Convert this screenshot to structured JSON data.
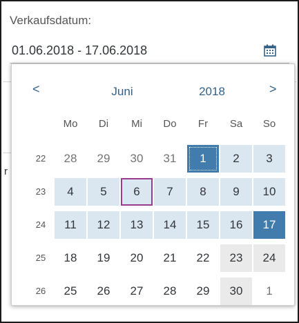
{
  "field": {
    "label": "Verkaufsdatum:",
    "value": "01.06.2018 - 17.06.2018",
    "icon": "calendar-icon"
  },
  "background": {
    "fragment": "r"
  },
  "calendar": {
    "prev": "<",
    "next": ">",
    "month": "Juni",
    "year": "2018",
    "weekdays": [
      "Mo",
      "Di",
      "Mi",
      "Do",
      "Fr",
      "Sa",
      "So"
    ],
    "colors": {
      "accent": "#346187",
      "range": "#dae6f0",
      "endpoint": "#427cac",
      "weekend": "#eaeaea",
      "today_border": "#9b3b8f"
    },
    "weeks": [
      {
        "week": "22",
        "days": [
          {
            "d": "28",
            "type": "other"
          },
          {
            "d": "29",
            "type": "other"
          },
          {
            "d": "30",
            "type": "other"
          },
          {
            "d": "31",
            "type": "other"
          },
          {
            "d": "1",
            "type": "start"
          },
          {
            "d": "2",
            "type": "range"
          },
          {
            "d": "3",
            "type": "range"
          }
        ]
      },
      {
        "week": "23",
        "days": [
          {
            "d": "4",
            "type": "range"
          },
          {
            "d": "5",
            "type": "range"
          },
          {
            "d": "6",
            "type": "today"
          },
          {
            "d": "7",
            "type": "range"
          },
          {
            "d": "8",
            "type": "range"
          },
          {
            "d": "9",
            "type": "range"
          },
          {
            "d": "10",
            "type": "range"
          }
        ]
      },
      {
        "week": "24",
        "days": [
          {
            "d": "11",
            "type": "range"
          },
          {
            "d": "12",
            "type": "range"
          },
          {
            "d": "13",
            "type": "range"
          },
          {
            "d": "14",
            "type": "range"
          },
          {
            "d": "15",
            "type": "range"
          },
          {
            "d": "16",
            "type": "range"
          },
          {
            "d": "17",
            "type": "end"
          }
        ]
      },
      {
        "week": "25",
        "days": [
          {
            "d": "18",
            "type": "normal"
          },
          {
            "d": "19",
            "type": "normal"
          },
          {
            "d": "20",
            "type": "normal"
          },
          {
            "d": "21",
            "type": "normal"
          },
          {
            "d": "22",
            "type": "normal"
          },
          {
            "d": "23",
            "type": "weekend"
          },
          {
            "d": "24",
            "type": "weekend"
          }
        ]
      },
      {
        "week": "26",
        "days": [
          {
            "d": "25",
            "type": "normal"
          },
          {
            "d": "26",
            "type": "normal"
          },
          {
            "d": "27",
            "type": "normal"
          },
          {
            "d": "28",
            "type": "normal"
          },
          {
            "d": "29",
            "type": "normal"
          },
          {
            "d": "30",
            "type": "weekend"
          },
          {
            "d": "1",
            "type": "other"
          }
        ]
      }
    ]
  }
}
